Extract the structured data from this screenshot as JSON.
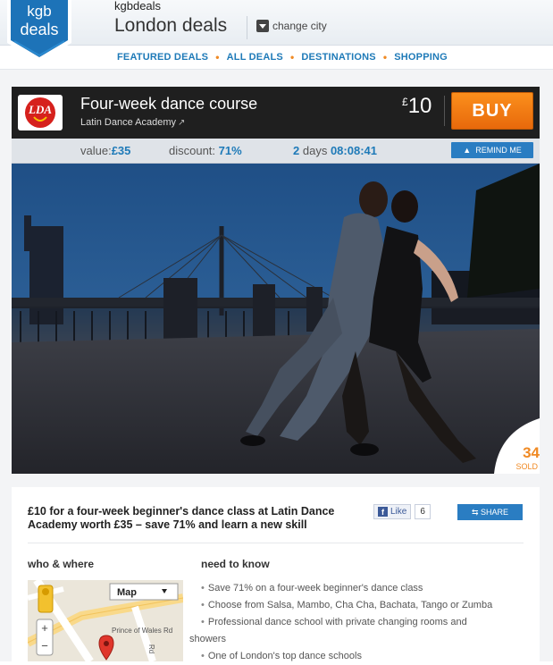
{
  "header": {
    "logo_line1": "kgb",
    "logo_line2": "deals",
    "brand": "kgbdeals",
    "city": "London deals",
    "change_city": "change city"
  },
  "nav": {
    "items": [
      "FEATURED DEALS",
      "ALL DEALS",
      "DESTINATIONS",
      "SHOPPING"
    ]
  },
  "deal": {
    "merchant_logo_text": "LDA",
    "title": "Four-week dance course",
    "merchant": "Latin Dance Academy",
    "currency": "£",
    "price": "10",
    "buy_label": "BUY",
    "value_label": "value:",
    "value": "£35",
    "discount_label": "discount:",
    "discount": "71%",
    "days": "2",
    "days_label": "days",
    "countdown": "08:08:41",
    "remind_label": "REMIND ME",
    "sold_count": "34",
    "sold_label": "SOLD"
  },
  "details": {
    "headline": "£10 for a four-week beginner's dance class at Latin Dance Academy worth £35 – save 71% and learn a new skill",
    "like_label": "Like",
    "like_count": "6",
    "share_label": "SHARE",
    "who_where": "who & where",
    "need_to_know": "need to know",
    "map_type": "Map",
    "map_street1": "Prince of Wales Rd",
    "map_street2": "Rd",
    "map_zoom_in": "+",
    "map_zoom_out": "−",
    "need_items": [
      "Save 71% on a four-week beginner's dance class",
      "Choose from Salsa, Mambo, Cha Cha, Bachata, Tango or Zumba",
      "Professional dance school with private changing rooms and",
      "showers",
      "One of London's top dance schools"
    ]
  },
  "colors": {
    "accent_blue": "#1e7ab8",
    "buy_orange": "#f08a24",
    "deal_bar": "#1f1f1f"
  }
}
